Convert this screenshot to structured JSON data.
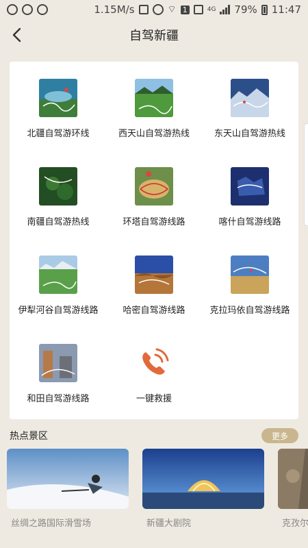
{
  "status_bar": {
    "speed": "1.15M/s",
    "network_label": "4G",
    "battery": "79%",
    "time": "11:47",
    "notification_badge": "1"
  },
  "header": {
    "title": "自驾新疆",
    "back_icon": "chevron-left-icon"
  },
  "routes": [
    {
      "label": "北疆自驾游环线"
    },
    {
      "label": "西天山自驾游热线"
    },
    {
      "label": "东天山自驾游热线"
    },
    {
      "label": "南疆自驾游热线"
    },
    {
      "label": "环塔自驾游线路"
    },
    {
      "label": "喀什自驾游线路"
    },
    {
      "label": "伊犁河谷自驾游线路"
    },
    {
      "label": "哈密自驾游线路"
    },
    {
      "label": "克拉玛依自驾游线路"
    },
    {
      "label": "和田自驾游线路"
    },
    {
      "label": "一键救援",
      "icon": "phone-icon"
    }
  ],
  "hot": {
    "title": "热点景区",
    "more_label": "更多",
    "spots": [
      {
        "name": "丝绸之路国际滑雪场"
      },
      {
        "name": "新疆大剧院"
      },
      {
        "name": "克孜尔"
      }
    ]
  },
  "colors": {
    "background": "#efeae1",
    "accent_gold": "#c9b68e",
    "phone_orange": "#e2693c"
  }
}
